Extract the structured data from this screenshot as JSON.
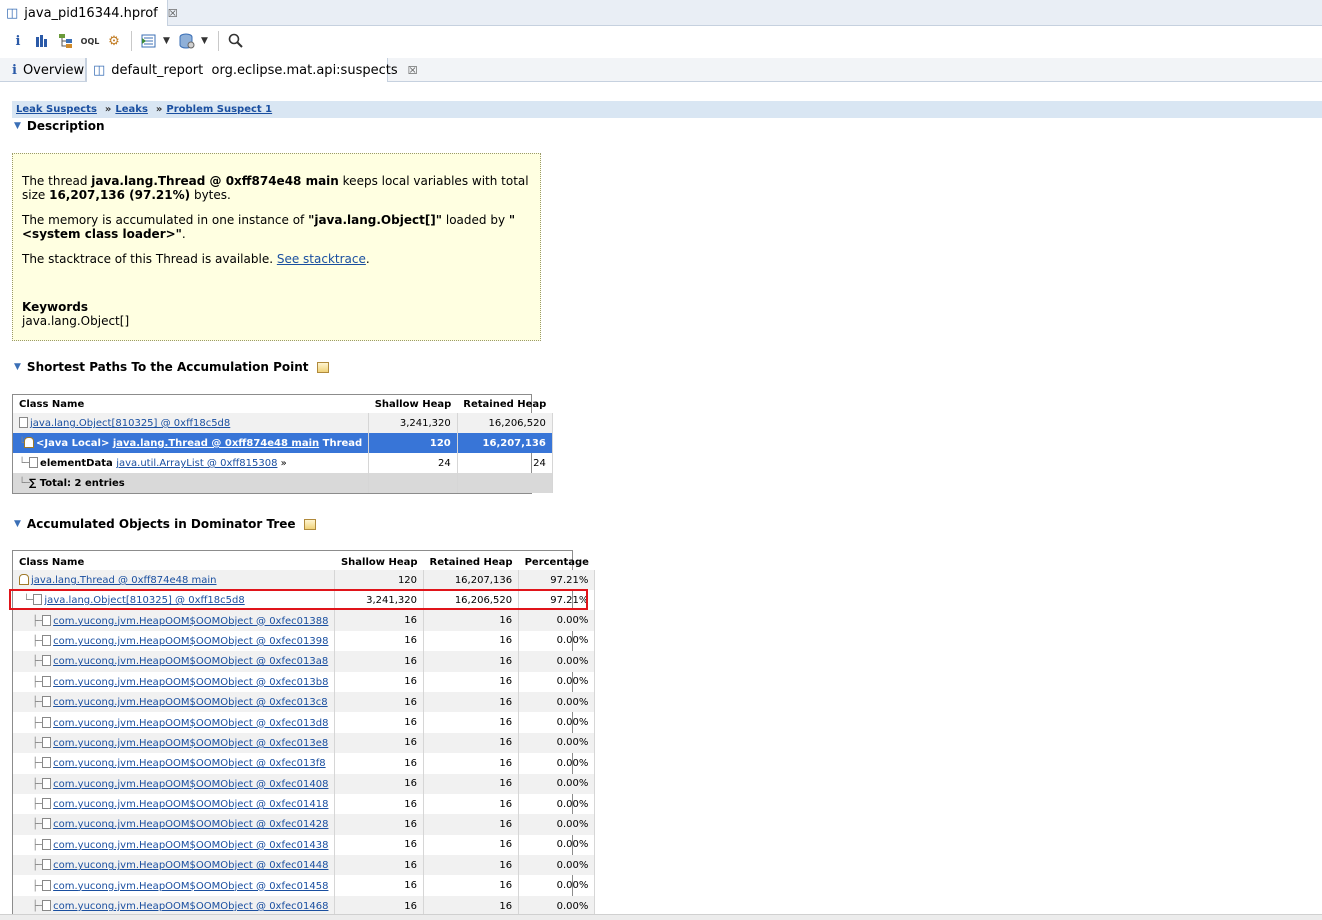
{
  "editor_tab": {
    "title": "java_pid16344.hprof",
    "close": "☒"
  },
  "toolbar": {
    "buttons": [
      "info-icon",
      "histogram-icon",
      "dominator-tree-icon",
      "oql-icon",
      "settings-icon",
      "query-browser-icon",
      "heap-dump-icon",
      "search-icon"
    ]
  },
  "sub_tabs": {
    "overview": "Overview",
    "report": "default_report  org.eclipse.mat.api:suspects",
    "close": "☒"
  },
  "breadcrumb": [
    "Leak Suspects",
    "Leaks",
    "Problem Suspect 1"
  ],
  "description": {
    "heading": "Description",
    "p1_pre": "The thread ",
    "p1_bold": "java.lang.Thread @ 0xff874e48 main",
    "p1_mid": " keeps local variables with total size ",
    "p1_bold2": "16,207,136 (97.21%)",
    "p1_post": " bytes.",
    "p2_pre": "The memory is accumulated in one instance of ",
    "p2_bold": "\"java.lang.Object[]\"",
    "p2_mid": " loaded by ",
    "p2_bold2": "\"<system class loader>\"",
    "p2_post": ".",
    "p3_pre": "The stacktrace of this Thread is available. ",
    "p3_link": "See stacktrace",
    "p3_post": ".",
    "keywords_title": "Keywords",
    "keywords": "java.lang.Object[]"
  },
  "paths": {
    "heading": "Shortest Paths To the Accumulation Point",
    "columns": [
      "Class Name",
      "Shallow Heap",
      "Retained Heap"
    ],
    "row0": {
      "name": "java.lang.Object[810325] @ 0xff18c5d8",
      "shallow": "3,241,320",
      "retained": "16,206,520"
    },
    "row1": {
      "prefix": "<Java Local> ",
      "name": "java.lang.Thread @ 0xff874e48 main",
      "suffix": " Thread",
      "shallow": "120",
      "retained": "16,207,136"
    },
    "row2": {
      "prefix": "elementData ",
      "name": "java.util.ArrayList @ 0xff815308",
      "suffix": " »",
      "shallow": "24",
      "retained": "24"
    },
    "total": "Total: 2 entries"
  },
  "dominator": {
    "heading": "Accumulated Objects in Dominator Tree",
    "columns": [
      "Class Name",
      "Shallow Heap",
      "Retained Heap",
      "Percentage"
    ],
    "rows": [
      {
        "name": "java.lang.Thread @ 0xff874e48 main",
        "shallow": "120",
        "retained": "16,207,136",
        "pct": "97.21%"
      },
      {
        "name": "java.lang.Object[810325] @ 0xff18c5d8",
        "shallow": "3,241,320",
        "retained": "16,206,520",
        "pct": "97.21%"
      },
      {
        "name": "com.yucong.jvm.HeapOOM$OOMObject @ 0xfec01388",
        "shallow": "16",
        "retained": "16",
        "pct": "0.00%"
      },
      {
        "name": "com.yucong.jvm.HeapOOM$OOMObject @ 0xfec01398",
        "shallow": "16",
        "retained": "16",
        "pct": "0.00%"
      },
      {
        "name": "com.yucong.jvm.HeapOOM$OOMObject @ 0xfec013a8",
        "shallow": "16",
        "retained": "16",
        "pct": "0.00%"
      },
      {
        "name": "com.yucong.jvm.HeapOOM$OOMObject @ 0xfec013b8",
        "shallow": "16",
        "retained": "16",
        "pct": "0.00%"
      },
      {
        "name": "com.yucong.jvm.HeapOOM$OOMObject @ 0xfec013c8",
        "shallow": "16",
        "retained": "16",
        "pct": "0.00%"
      },
      {
        "name": "com.yucong.jvm.HeapOOM$OOMObject @ 0xfec013d8",
        "shallow": "16",
        "retained": "16",
        "pct": "0.00%"
      },
      {
        "name": "com.yucong.jvm.HeapOOM$OOMObject @ 0xfec013e8",
        "shallow": "16",
        "retained": "16",
        "pct": "0.00%"
      },
      {
        "name": "com.yucong.jvm.HeapOOM$OOMObject @ 0xfec013f8",
        "shallow": "16",
        "retained": "16",
        "pct": "0.00%"
      },
      {
        "name": "com.yucong.jvm.HeapOOM$OOMObject @ 0xfec01408",
        "shallow": "16",
        "retained": "16",
        "pct": "0.00%"
      },
      {
        "name": "com.yucong.jvm.HeapOOM$OOMObject @ 0xfec01418",
        "shallow": "16",
        "retained": "16",
        "pct": "0.00%"
      },
      {
        "name": "com.yucong.jvm.HeapOOM$OOMObject @ 0xfec01428",
        "shallow": "16",
        "retained": "16",
        "pct": "0.00%"
      },
      {
        "name": "com.yucong.jvm.HeapOOM$OOMObject @ 0xfec01438",
        "shallow": "16",
        "retained": "16",
        "pct": "0.00%"
      },
      {
        "name": "com.yucong.jvm.HeapOOM$OOMObject @ 0xfec01448",
        "shallow": "16",
        "retained": "16",
        "pct": "0.00%"
      },
      {
        "name": "com.yucong.jvm.HeapOOM$OOMObject @ 0xfec01458",
        "shallow": "16",
        "retained": "16",
        "pct": "0.00%"
      },
      {
        "name": "com.yucong.jvm.HeapOOM$OOMObject @ 0xfec01468",
        "shallow": "16",
        "retained": "16",
        "pct": "0.00%"
      }
    ]
  },
  "colors": {
    "accent": "#3875d7",
    "highlight_box": "#e0141a",
    "desc_bg": "#ffffe1",
    "link": "#1a4fa0"
  }
}
